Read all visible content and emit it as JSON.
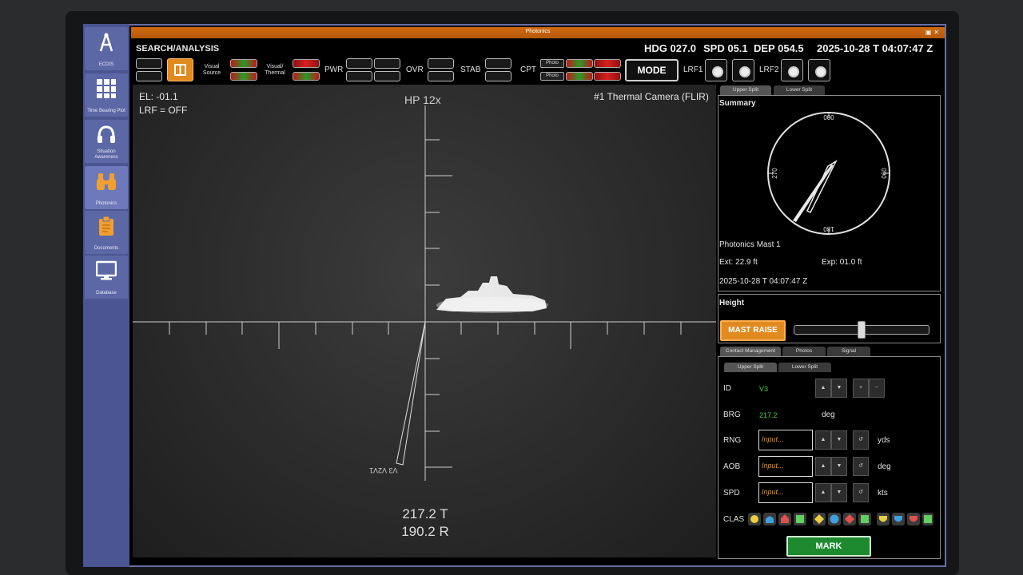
{
  "window": {
    "title": "Photonics"
  },
  "nav": {
    "items": [
      {
        "label": "ECDIS",
        "icon": "compass-icon"
      },
      {
        "label": "Time Bearing Plot",
        "icon": "grid-icon"
      },
      {
        "label": "Situation Awareness",
        "icon": "headphones-icon"
      },
      {
        "label": "Photonics",
        "icon": "binoculars-icon"
      },
      {
        "label": "Documents",
        "icon": "clipboard-icon"
      },
      {
        "label": "Database",
        "icon": "monitor-icon"
      }
    ]
  },
  "toolbar": {
    "section": "SEARCH/ANALYSIS",
    "visual_source": "Visual Source",
    "visual_thermal": "Visual/ Thermal",
    "pwr": "PWR",
    "ovr": "OVR",
    "stab": "STAB",
    "cpt": "CPT",
    "photo_1": "Photo",
    "photo_2": "Photo",
    "mode": "MODE",
    "lrf1": "LRF1",
    "lrf2": "LRF2"
  },
  "status": {
    "hdg": "HDG 027.0",
    "spd": "SPD 05.1",
    "dep": "DEP 054.5",
    "datetime": "2025-10-28 T 04:07:47 Z"
  },
  "camera": {
    "elevation": "EL: -01.1",
    "lrf_state": "LRF = OFF",
    "zoom": "HP 12x",
    "source": "#1 Thermal Camera (FLIR)",
    "bearing_true": "217.2 T",
    "bearing_rel": "190.2 R",
    "contact_tag": "V3 V2V1"
  },
  "summary": {
    "tab_upper": "Upper Split",
    "tab_lower": "Lower Split",
    "title": "Summary",
    "compass": {
      "n": "000",
      "e": "090",
      "s": "180",
      "w": "270"
    },
    "mast": "Photonics Mast 1",
    "ext": "Ext: 22.9 ft",
    "exp": "Exp: 01.0 ft",
    "datetime": "2025-10-28 T 04:07:47 Z"
  },
  "height": {
    "title": "Height",
    "mast_raise": "MAST RAISE",
    "slider_fraction": 0.5
  },
  "contact": {
    "tabs": [
      "Contact Management",
      "Photos",
      "Signal"
    ],
    "subtab_upper": "Upper Split",
    "subtab_lower": "Lower Split",
    "id_label": "ID",
    "id_value": "V3",
    "brg_label": "BRG",
    "brg_value": "217.2",
    "brg_unit": "deg",
    "rng_label": "RNG",
    "rng_placeholder": "Input...",
    "rng_unit": "yds",
    "aob_label": "AOB",
    "aob_placeholder": "Input...",
    "aob_unit": "deg",
    "spd_label": "SPD",
    "spd_placeholder": "Input...",
    "spd_unit": "kts",
    "clas_label": "CLAS",
    "mark": "MARK"
  },
  "colors": {
    "accent": "#e08a20",
    "nav": "#5c67a6",
    "ok": "#1d8a30",
    "value": "#40d040"
  }
}
